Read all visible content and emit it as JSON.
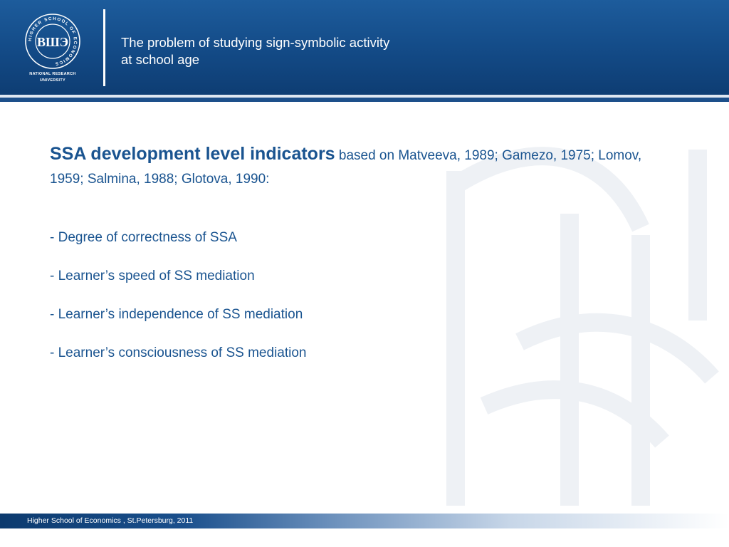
{
  "header": {
    "title_line1": "The problem of studying sign-symbolic activity",
    "title_line2": "at school age",
    "logo_icon": "hse-seal-icon",
    "logo_ring_text": "HIGHER SCHOOL OF ECONOMICS",
    "logo_letters": "ВШЭ",
    "logo_caption_line1": "NATIONAL RESEARCH",
    "logo_caption_line2": "UNIVERSITY"
  },
  "main": {
    "heading_strong": "SSA development level indicators",
    "heading_rest": " based on Matveeva, 1989; Gamezo, 1975; Lomov, 1959; Salmina, 1988; Glotova, 1990:",
    "bullets": [
      "- Degree of correctness of SSA",
      "- Learner’s  speed of SS mediation",
      "- Learner’s independence of SS mediation",
      "- Learner’s  consciousness of SS mediation"
    ]
  },
  "footer": {
    "text": "Higher School of Economics , St.Petersburg, 2011"
  },
  "colors": {
    "header_blue": "#134a86",
    "text_blue": "#1a5490",
    "watermark": "#f1f3f6"
  }
}
